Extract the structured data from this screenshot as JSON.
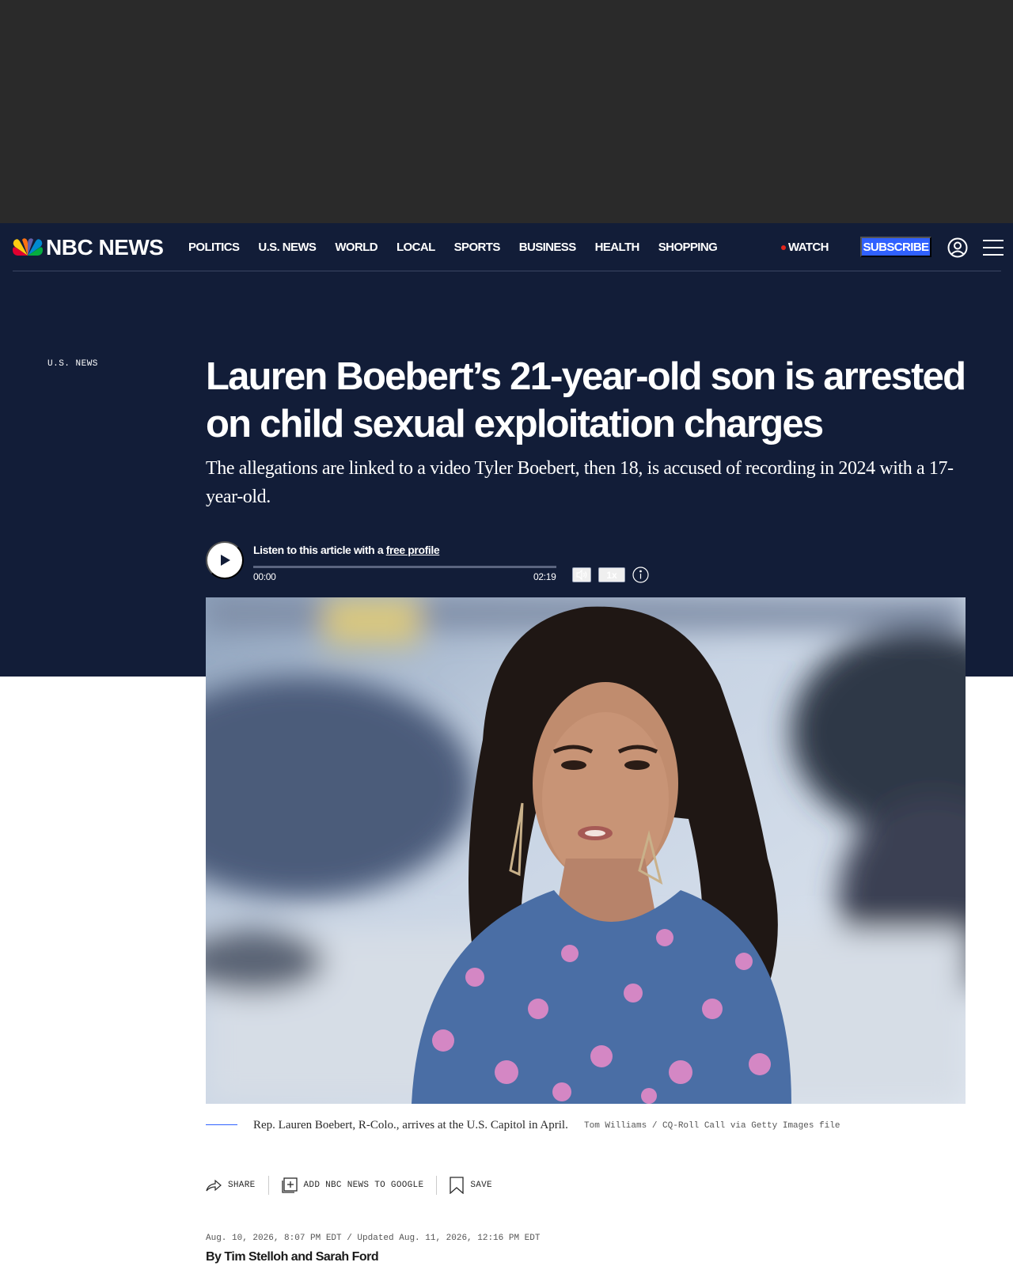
{
  "header": {
    "logo_text": "NBC NEWS",
    "nav_items": [
      "POLITICS",
      "U.S. NEWS",
      "WORLD",
      "LOCAL",
      "SPORTS",
      "BUSINESS",
      "HEALTH",
      "SHOPPING"
    ],
    "watch_label": "WATCH",
    "subscribe_label": "SUBSCRIBE",
    "icons": [
      "nbc-peacock-icon",
      "account-icon",
      "hamburger-menu-icon"
    ]
  },
  "article": {
    "section": "U.S. NEWS",
    "headline": "Lauren Boebert’s 21-year-old son is arrested on child sexual exploitation charges",
    "dek": "The allegations are linked to a video Tyler Boebert, then 18, is accused of recording in 2024 with a 17-year-old.",
    "audio": {
      "prompt_prefix": "Listen to this article with a ",
      "prompt_link": "free profile",
      "time_current": "00:00",
      "time_total": "02:19",
      "speed": "1x",
      "progress": 0.0
    },
    "caption": {
      "text": "Rep. Lauren Boebert, R-Colo., arrives at the U.S. Capitol in April.",
      "credit": "Tom Williams / CQ-Roll Call via Getty Images file"
    },
    "share": {
      "share_label": "SHARE",
      "google_label": "ADD NBC NEWS TO GOOGLE",
      "save_label": "SAVE"
    },
    "dateline": "Aug. 10, 2026, 8:07 PM EDT / Updated Aug. 11, 2026, 12:16 PM EDT",
    "byline_prefix": "By ",
    "author_1": "Tim Stelloh",
    "byline_and": " and ",
    "author_2": "Sarah Ford"
  },
  "colors": {
    "navy": "#121d38",
    "accent_blue": "#3061ff",
    "live_red": "#e4261c",
    "ad_gray": "#2a2a2a"
  }
}
